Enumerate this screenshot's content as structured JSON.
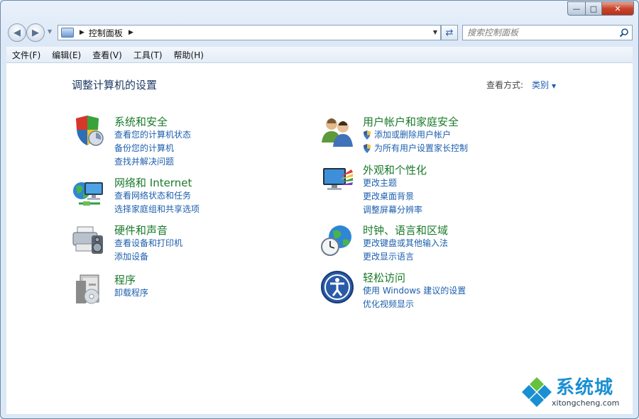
{
  "navigation": {
    "address_crumb": "控制面板",
    "search_placeholder": "搜索控制面板"
  },
  "menu": [
    "文件(F)",
    "编辑(E)",
    "查看(V)",
    "工具(T)",
    "帮助(H)"
  ],
  "main": {
    "heading": "调整计算机的设置",
    "view_by_label": "查看方式:",
    "view_by_value": "类别"
  },
  "categories": [
    {
      "title": "系统和安全",
      "links": [
        "查看您的计算机状态",
        "备份您的计算机",
        "查找并解决问题"
      ],
      "icon": "system-security-icon"
    },
    {
      "title": "网络和 Internet",
      "links": [
        "查看网络状态和任务",
        "选择家庭组和共享选项"
      ],
      "icon": "network-icon"
    },
    {
      "title": "硬件和声音",
      "links": [
        "查看设备和打印机",
        "添加设备"
      ],
      "icon": "hardware-sound-icon"
    },
    {
      "title": "程序",
      "links": [
        "卸载程序"
      ],
      "icon": "programs-icon"
    },
    {
      "title": "用户帐户和家庭安全",
      "links": [
        "添加或删除用户帐户",
        "为所有用户设置家长控制"
      ],
      "icon": "user-accounts-icon"
    },
    {
      "title": "外观和个性化",
      "links": [
        "更改主题",
        "更改桌面背景",
        "调整屏幕分辨率"
      ],
      "icon": "appearance-icon"
    },
    {
      "title": "时钟、语言和区域",
      "links": [
        "更改键盘或其他输入法",
        "更改显示语言"
      ],
      "icon": "clock-region-icon"
    },
    {
      "title": "轻松访问",
      "links": [
        "使用 Windows 建议的设置",
        "优化视频显示"
      ],
      "icon": "ease-of-access-icon"
    }
  ],
  "watermark": {
    "text": "系统城",
    "url": "xitongcheng.com"
  },
  "colors": {
    "category_title": "#1a7a2a",
    "link": "#1c5fae",
    "heading": "#1e3a63"
  }
}
